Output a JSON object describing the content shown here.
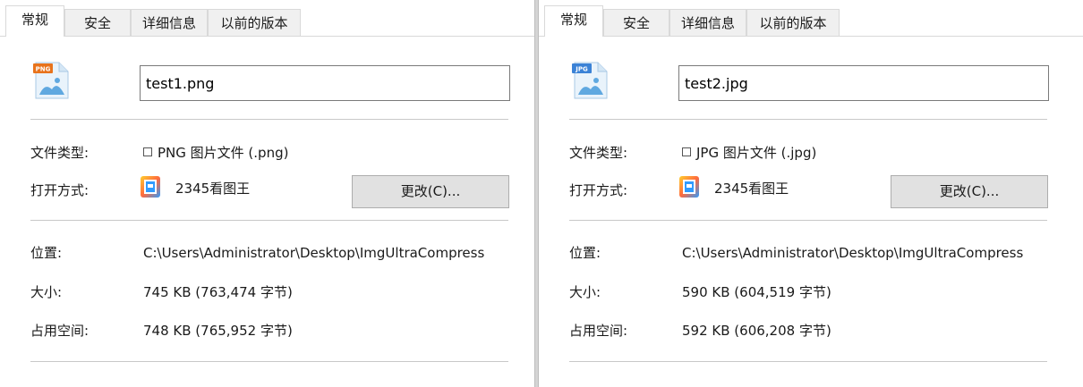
{
  "tabs": [
    "常规",
    "安全",
    "详细信息",
    "以前的版本"
  ],
  "labels": {
    "type": "文件类型:",
    "opens_with": "打开方式:",
    "location": "位置:",
    "size": "大小:",
    "size_on_disk": "占用空间:"
  },
  "change_button": "更改(C)...",
  "panels": [
    {
      "badge": "PNG",
      "filename": "test1.png",
      "file_type": "PNG 图片文件 (.png)",
      "app": "2345看图王",
      "location": "C:\\Users\\Administrator\\Desktop\\ImgUltraCompress",
      "size": "745 KB (763,474 字节)",
      "size_on_disk": "748 KB (765,952 字节)"
    },
    {
      "badge": "JPG",
      "filename": "test2.jpg",
      "file_type": "JPG 图片文件 (.jpg)",
      "app": "2345看图王",
      "location": "C:\\Users\\Administrator\\Desktop\\ImgUltraCompress",
      "size": "590 KB (604,519 字节)",
      "size_on_disk": "592 KB (606,208 字节)"
    }
  ],
  "colors": {
    "png_badge": "#e8731c",
    "jpg_badge": "#3b82d6",
    "icon_body": "#e9f3fb",
    "icon_accent": "#5fa8e0",
    "button_bg": "#e1e1e1",
    "divider": "#c8c8c8"
  },
  "icons": {
    "file_icon": "image-file-icon",
    "app_icon": "image-viewer-app-icon"
  }
}
